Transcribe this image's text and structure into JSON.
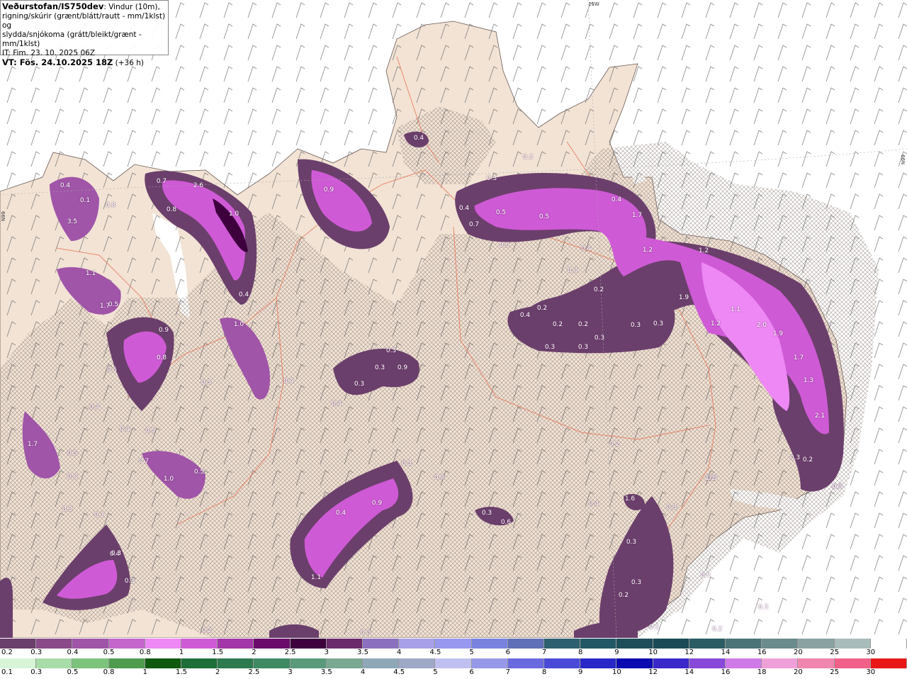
{
  "header": {
    "title": "Veðurstofan/IS750dev",
    "description_line1": ": Vindur (10m),",
    "description_line2": "rigning/skúrir (grænt/blátt/rautt - mm/1klst) og",
    "description_line3": "slydda/snjókoma (grátt/bleikt/grænt - mm/1klst)",
    "it_line": "IT: Fim. 23. 10. 2025 06Z",
    "vt_line": "VT: Fös. 24.10.2025 18Z",
    "vt_suffix": " (+36 h)"
  },
  "graticule_labels": {
    "lon_15w": "15W",
    "lat_66n": "66N"
  },
  "map_colors": {
    "sea": "#ffffff",
    "land": "#f2e3d5",
    "snow_hatch": "#8a7a74",
    "roads": "#e8795a",
    "precip_light": "#6b3f6b",
    "precip_mid": "#a055a8",
    "precip_bright": "#e070ec",
    "precip_peak": "#3d0a3d"
  },
  "precip_labels": [
    "0.4",
    "0.7",
    "2.6",
    "0.1",
    "0.8",
    "1.0",
    "3.5",
    "0.8",
    "1.1",
    "0.5",
    "0.9",
    "1.7",
    "0.4",
    "1.0",
    "0.9",
    "0.8",
    "0.5",
    "0.4",
    "0.3",
    "0.4",
    "0.5",
    "0.3",
    "0.3",
    "0.4",
    "0.3",
    "0.4",
    "0.4",
    "0.3",
    "0.9",
    "0.3",
    "0.3",
    "0.4",
    "0.3",
    "0.3",
    "0.4",
    "0.5",
    "0.7",
    "0.5",
    "0.5",
    "0.4",
    "1.7",
    "1.2",
    "1.2",
    "1.9",
    "0.4",
    "0.3",
    "0.2",
    "0.4",
    "0.2",
    "0.2",
    "0.2",
    "0.3",
    "0.3",
    "0.3",
    "0.3",
    "0.3",
    "1.1",
    "1.2",
    "2.0",
    "1.9",
    "1.7",
    "1.3",
    "2.1",
    "0.3",
    "0.2",
    "0.7",
    "0.2",
    "1.7",
    "0.5",
    "0.7",
    "1.0",
    "0.5",
    "0.3",
    "0.3",
    "0.3",
    "0.6",
    "0.4",
    "1.6",
    "0.4",
    "0.9",
    "1.1",
    "0.7",
    "0.3",
    "0.5",
    "0.3",
    "0.3",
    "0.2",
    "0.2",
    "0.2",
    "0.2",
    "1.2",
    "0.3",
    "0.3",
    "0.2",
    "0.3",
    "0.3"
  ],
  "legend_snow": {
    "labels": [
      "0.2",
      "0.3",
      "0.4",
      "0.5",
      "0.8",
      "1",
      "1.5",
      "2",
      "2.5",
      "3",
      "3.5",
      "4",
      "4.5",
      "5",
      "6",
      "7",
      "8",
      "9",
      "10",
      "12",
      "14",
      "16",
      "20",
      "25",
      "30"
    ],
    "colors": [
      "#6b3f6b",
      "#8a4a8a",
      "#a055a8",
      "#c466cc",
      "#ee88f4",
      "#cf5ad6",
      "#a336a8",
      "#6b0a6b",
      "#3d003d",
      "#6b2a6b",
      "#8c70c0",
      "#a8a0e8",
      "#9898f0",
      "#7a82e0",
      "#5f6fb8",
      "#2d6070",
      "#225866",
      "#1e4e5a",
      "#1a4a55",
      "#2a5c64",
      "#4a7478",
      "#6a8c8c",
      "#8aa2a2",
      "#a9bcbc",
      "#ffffff"
    ]
  },
  "legend_rain": {
    "labels": [
      "0.1",
      "0.3",
      "0.5",
      "0.8",
      "1",
      "1.5",
      "2",
      "2.5",
      "3",
      "3.5",
      "4",
      "4.5",
      "5",
      "6",
      "7",
      "8",
      "9",
      "10",
      "12",
      "14",
      "16",
      "18",
      "20",
      "25",
      "30"
    ],
    "colors": [
      "#d8f5d8",
      "#a8dca8",
      "#7cc47c",
      "#4f9c4f",
      "#0f5a0f",
      "#1e6e3a",
      "#2d7a4e",
      "#3f8a62",
      "#5a9a7a",
      "#7aa890",
      "#8ea8b8",
      "#a0a8c8",
      "#c0c0f0",
      "#9898e8",
      "#6a6ae0",
      "#4a4ad8",
      "#2828c8",
      "#0a0ab0",
      "#3a28c8",
      "#8848d8",
      "#d07ae8",
      "#f0a0d8",
      "#f086b0",
      "#f06088",
      "#e81818"
    ]
  }
}
